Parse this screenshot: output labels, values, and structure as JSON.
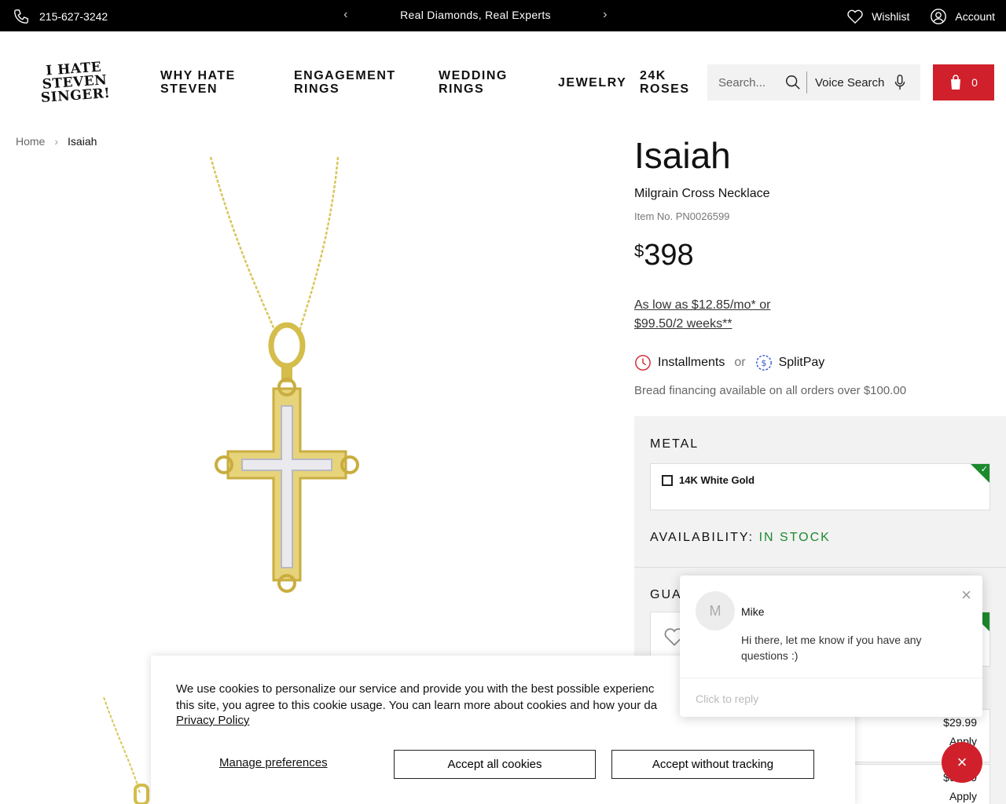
{
  "topbar": {
    "phone": "215-627-3242",
    "promo": "Real Diamonds, Real Experts",
    "wishlist": "Wishlist",
    "account": "Account"
  },
  "header": {
    "logo_line1": "I HATE",
    "logo_line2": "STEVEN SINGER!",
    "nav": [
      {
        "line1": "WHY HATE",
        "line2": "STEVEN"
      },
      {
        "line1": "ENGAGEMENT",
        "line2": "RINGS"
      },
      {
        "line1": "WEDDING",
        "line2": "RINGS"
      },
      {
        "line1": "JEWELRY",
        "line2": ""
      },
      {
        "line1": "24K",
        "line2": "ROSES"
      }
    ],
    "search_placeholder": "Search...",
    "voice_search": "Voice Search",
    "cart_count": "0"
  },
  "breadcrumb": {
    "home": "Home",
    "current": "Isaiah"
  },
  "product": {
    "title": "Isaiah",
    "subtitle": "Milgrain Cross Necklace",
    "item_no": "Item No. PN0026599",
    "currency": "$",
    "price": "398",
    "financing": "As low as $12.85/mo* or $99.50/2 weeks**",
    "installments": "Installments",
    "or": "or",
    "splitpay": "SplitPay",
    "bread_note": "Bread financing available on all orders over $100.00"
  },
  "options": {
    "metal_label": "METAL",
    "metal_value": "14K White Gold",
    "availability_label": "AVAILABILITY:",
    "availability_value": "IN STOCK",
    "guarantee_label": "GUA",
    "addon1_price": "$29.99",
    "addon1_action": "Apply",
    "addon2_price": "$99.99",
    "addon2_action": "Apply"
  },
  "cookie": {
    "text_line1": "We use cookies to personalize our service and provide you with the best possible experienc",
    "text_line2": "this site, you agree to this cookie usage. You can learn more about cookies and how your da",
    "policy": "Privacy Policy",
    "manage": "Manage preferences",
    "accept_all": "Accept all cookies",
    "accept_no_tracking": "Accept without tracking"
  },
  "chat": {
    "avatar_initial": "M",
    "agent": "Mike",
    "message": "Hi there, let me know if you have any questions :)",
    "reply_placeholder": "Click to reply",
    "close_glyph": "×",
    "fab_glyph": "×"
  },
  "colors": {
    "brand_red": "#d0202b",
    "in_stock_green": "#1b8a2e",
    "topbar_bg": "#000000"
  }
}
